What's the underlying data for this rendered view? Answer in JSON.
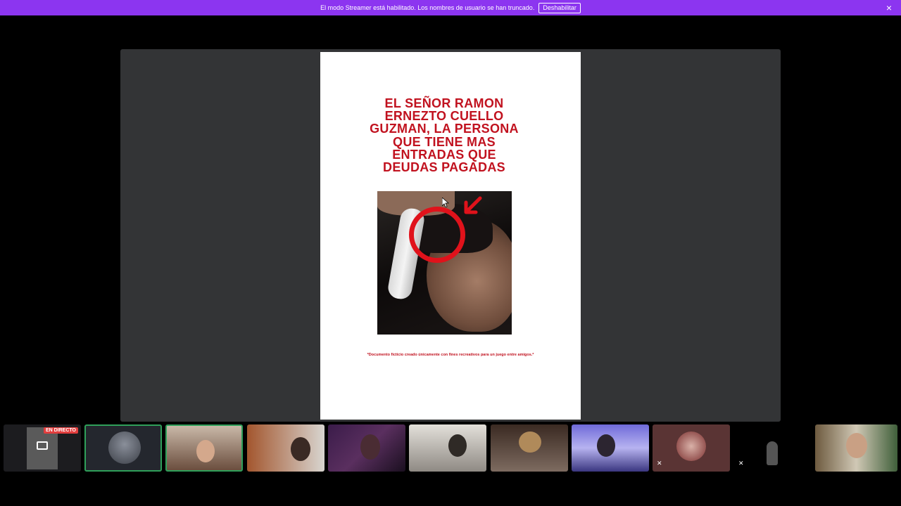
{
  "banner": {
    "message": "El modo Streamer está habilitado. Los nombres de usuario se han truncado.",
    "button_label": "Deshabilitar",
    "background": "#8c35f0"
  },
  "document": {
    "title_lines": [
      "EL SEÑOR RAMON",
      "ERNEZTO CUELLO",
      "GUZMAN, LA PERSONA",
      "QUE TIENE MAS",
      "ENTRADAS QUE",
      "DEUDAS PAGADAS"
    ],
    "disclaimer": "*Documento ficticio creado únicamente con fines recreativos para un juego entre amigos.*",
    "accent": "#c1121f"
  },
  "participants": {
    "live_badge": "EN DIRECTO",
    "tiles": [
      {
        "kind": "screenshare-icon"
      },
      {
        "kind": "avatar"
      },
      {
        "kind": "camera"
      },
      {
        "kind": "camera"
      },
      {
        "kind": "camera"
      },
      {
        "kind": "camera"
      },
      {
        "kind": "camera"
      },
      {
        "kind": "camera"
      },
      {
        "kind": "avatar-muted"
      },
      {
        "kind": "silhouette-muted"
      },
      {
        "kind": "camera"
      }
    ]
  }
}
